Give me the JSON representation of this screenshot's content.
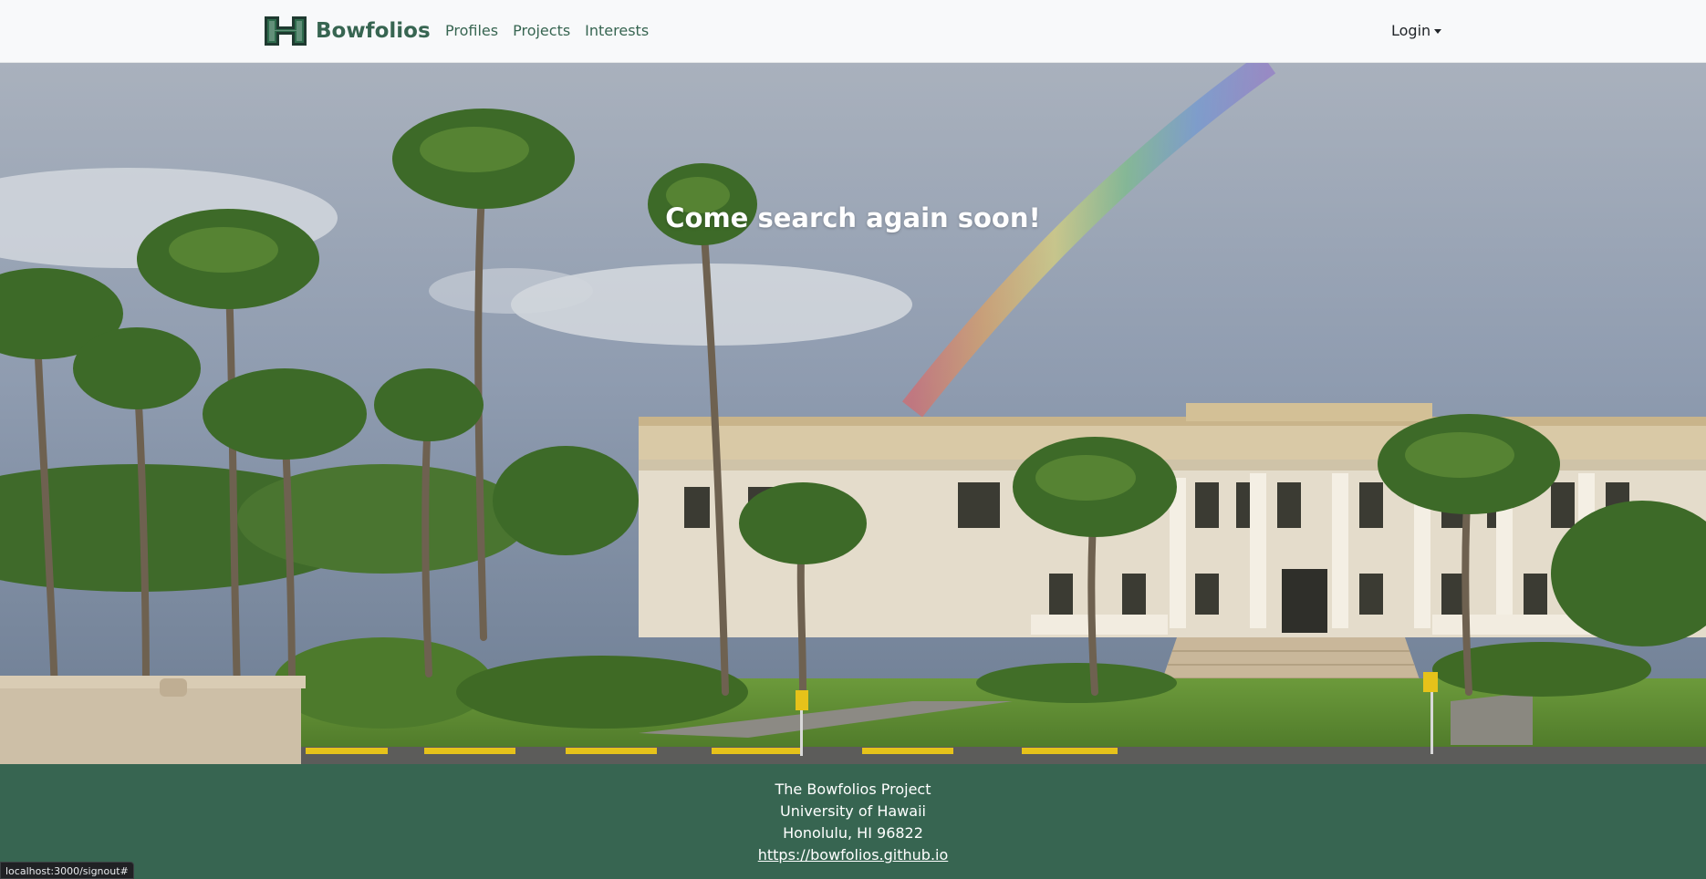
{
  "navbar": {
    "brand": "Bowfolios",
    "logo_icon": "letter-h-logo",
    "links": [
      "Profiles",
      "Projects",
      "Interests"
    ],
    "login": "Login"
  },
  "hero": {
    "heading": "Come search again soon!"
  },
  "footer": {
    "line1": "The Bowfolios Project",
    "line2": "University of Hawaii",
    "line3": "Honolulu, HI 96822",
    "link": "https://bowfolios.github.io"
  },
  "status": {
    "url": "localhost:3000/signout#"
  },
  "colors": {
    "brand_green": "#376551",
    "navbar_bg": "#f8f9fa"
  }
}
